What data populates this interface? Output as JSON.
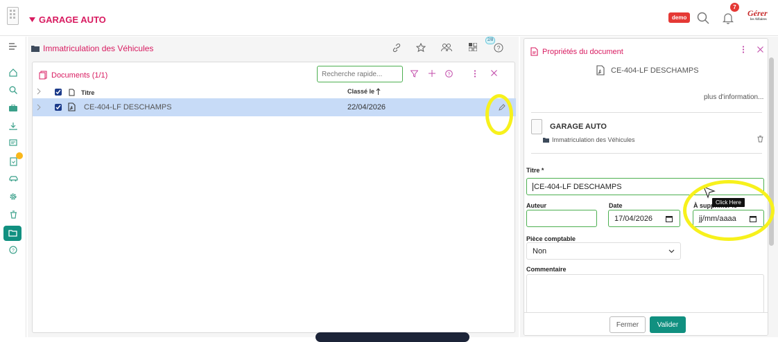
{
  "topbar": {
    "organization": "GARAGE AUTO",
    "demo_badge": "demo",
    "notifications_count": "7",
    "user_logo_text": "Gérer",
    "user_logo_sub": "les Affaires"
  },
  "folder": {
    "title": "Immatriculation des Véhicules",
    "panel_badge": "2/8"
  },
  "documents": {
    "title": "Documents (1/1)",
    "search_placeholder": "Recherche rapide...",
    "columns": {
      "title": "Titre",
      "classified": "Classé le"
    },
    "rows": [
      {
        "title": "CE-404-LF DESCHAMPS",
        "date": "22/04/2026"
      }
    ]
  },
  "properties": {
    "header": "Propriétés du document",
    "doc_name": "CE-404-LF DESCHAMPS",
    "more_info": "plus d'information...",
    "org": "GARAGE AUTO",
    "folder": "Immatriculation des Véhicules",
    "labels": {
      "title": "Titre *",
      "author": "Auteur",
      "date": "Date",
      "delete_on": "À supprimer le",
      "accounting": "Pièce comptable",
      "comment": "Commentaire"
    },
    "values": {
      "title": "CE-404-LF DESCHAMPS",
      "author": "",
      "date": "17/04/2026",
      "delete_on_placeholder": "jj/mm/aaaa",
      "accounting": "Non"
    },
    "tooltip": "Click Here",
    "buttons": {
      "close": "Fermer",
      "validate": "Valider"
    }
  },
  "colors": {
    "accent": "#d81b60",
    "teal": "#119080",
    "selection": "#c7dbf7",
    "highlight": "#f7f11c"
  }
}
